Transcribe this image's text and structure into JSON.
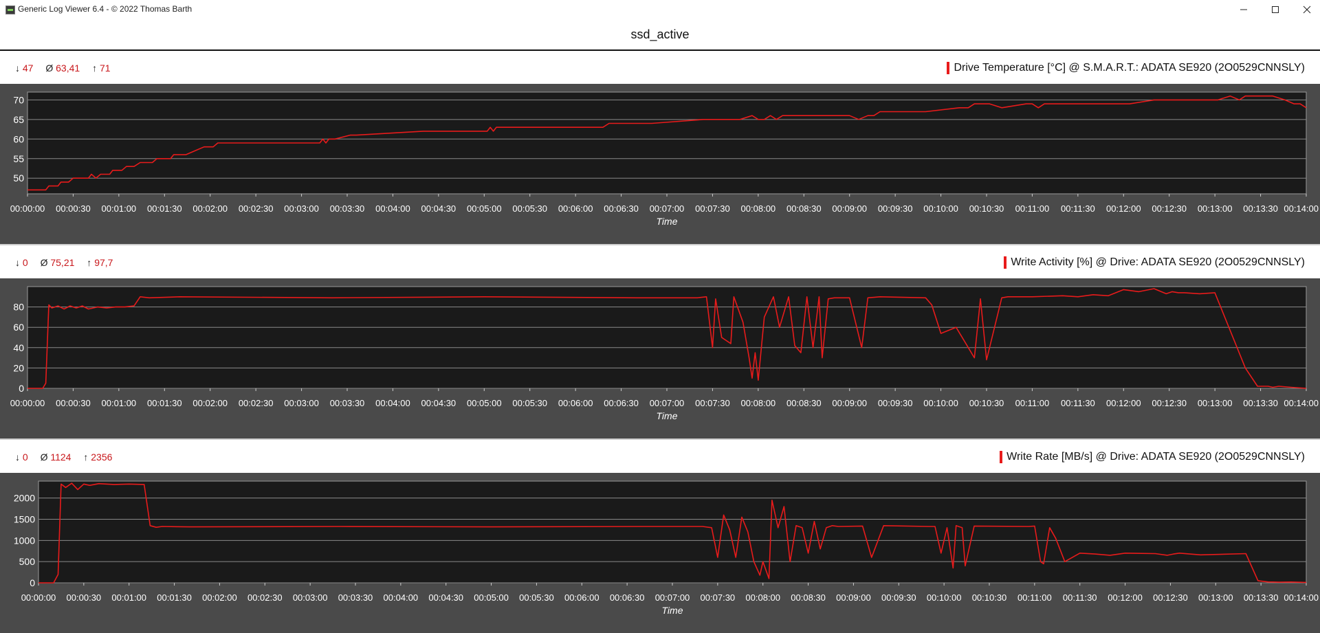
{
  "window": {
    "title": "Generic Log Viewer 6.4 - © 2022 Thomas Barth",
    "caption": "ssd_active"
  },
  "time_ticks": [
    "00:00:00",
    "00:00:30",
    "00:01:00",
    "00:01:30",
    "00:02:00",
    "00:02:30",
    "00:03:00",
    "00:03:30",
    "00:04:00",
    "00:04:30",
    "00:05:00",
    "00:05:30",
    "00:06:00",
    "00:06:30",
    "00:07:00",
    "00:07:30",
    "00:08:00",
    "00:08:30",
    "00:09:00",
    "00:09:30",
    "00:10:00",
    "00:10:30",
    "00:11:00",
    "00:11:30",
    "00:12:00",
    "00:12:30",
    "00:13:00",
    "00:13:30",
    "00:14:00"
  ],
  "colors": {
    "series": "#e81b1b",
    "plot_bg": "#1a1a1a",
    "frame_bg": "#4a4a4a",
    "grid": "#8a8a8a",
    "stats": "#c8161a"
  },
  "panels": [
    {
      "stats": {
        "min_symbol": "↓",
        "min": "47",
        "avg_symbol": "Ø",
        "avg": "63,41",
        "max_symbol": "↑",
        "max": "71"
      },
      "legend": "Drive Temperature [°C] @ S.M.A.R.T.: ADATA SE920 (2O0529CNNSLY)"
    },
    {
      "stats": {
        "min_symbol": "↓",
        "min": "0",
        "avg_symbol": "Ø",
        "avg": "75,21",
        "max_symbol": "↑",
        "max": "97,7"
      },
      "legend": "Write Activity [%] @ Drive: ADATA SE920 (2O0529CNNSLY)"
    },
    {
      "stats": {
        "min_symbol": "↓",
        "min": "0",
        "avg_symbol": "Ø",
        "avg": "1124",
        "max_symbol": "↑",
        "max": "2356"
      },
      "legend": "Write Rate [MB/s] @ Drive: ADATA SE920 (2O0529CNNSLY)"
    }
  ],
  "chart_data": [
    {
      "type": "line",
      "xlabel": "Time",
      "ylabel": "",
      "xlim": [
        0,
        840
      ],
      "ylim": [
        46,
        72
      ],
      "yticks": [
        50,
        55,
        60,
        65,
        70
      ],
      "grid": true,
      "series": [
        {
          "name": "Drive Temperature [°C] @ S.M.A.R.T.: ADATA SE920 (2O0529CNNSLY)",
          "x": [
            0,
            12,
            14,
            20,
            22,
            27,
            30,
            40,
            42,
            45,
            48,
            54,
            56,
            62,
            65,
            70,
            74,
            82,
            85,
            88,
            94,
            96,
            104,
            110,
            116,
            122,
            125,
            128,
            134,
            140,
            192,
            194,
            196,
            198,
            202,
            212,
            216,
            260,
            264,
            302,
            304,
            306,
            308,
            312,
            378,
            382,
            410,
            444,
            468,
            476,
            480,
            484,
            488,
            492,
            496,
            504,
            508,
            540,
            546,
            552,
            556,
            560,
            564,
            590,
            612,
            618,
            622,
            624,
            632,
            640,
            656,
            660,
            664,
            668,
            724,
            740,
            748,
            756,
            782,
            790,
            796,
            800,
            808,
            812,
            818,
            826,
            832,
            836,
            840
          ],
          "y": [
            47,
            47,
            48,
            48,
            49,
            49,
            50,
            50,
            51,
            50,
            51,
            51,
            52,
            52,
            53,
            53,
            54,
            54,
            55,
            55,
            55,
            56,
            56,
            57,
            58,
            58,
            59,
            59,
            59,
            59,
            59,
            60,
            59,
            60,
            60,
            61,
            61,
            62,
            62,
            62,
            63,
            62,
            63,
            63,
            63,
            64,
            64,
            65,
            65,
            66,
            65,
            65,
            66,
            65,
            66,
            66,
            66,
            66,
            65,
            66,
            66,
            67,
            67,
            67,
            68,
            68,
            69,
            69,
            69,
            68,
            69,
            69,
            68,
            69,
            69,
            70,
            70,
            70,
            70,
            71,
            70,
            71,
            71,
            71,
            71,
            70,
            69,
            69,
            68
          ]
        }
      ]
    },
    {
      "type": "line",
      "xlabel": "Time",
      "ylabel": "",
      "xlim": [
        0,
        840
      ],
      "ylim": [
        0,
        100
      ],
      "yticks": [
        0,
        20,
        40,
        60,
        80
      ],
      "grid": true,
      "series": [
        {
          "name": "Write Activity [%] @ Drive: ADATA SE920 (2O0529CNNSLY)",
          "x": [
            0,
            10,
            12,
            14,
            16,
            20,
            24,
            28,
            32,
            36,
            40,
            46,
            52,
            58,
            64,
            70,
            74,
            80,
            100,
            200,
            300,
            400,
            440,
            446,
            450,
            452,
            456,
            462,
            464,
            470,
            474,
            476,
            478,
            480,
            484,
            490,
            494,
            500,
            504,
            508,
            512,
            516,
            520,
            522,
            526,
            530,
            540,
            548,
            552,
            560,
            590,
            594,
            600,
            610,
            622,
            626,
            630,
            640,
            644,
            650,
            660,
            680,
            690,
            700,
            710,
            720,
            730,
            740,
            748,
            752,
            756,
            760,
            770,
            780,
            800,
            808,
            815,
            818,
            822,
            830,
            840
          ],
          "y": [
            0,
            0,
            5,
            82,
            79,
            81,
            78,
            81,
            79,
            81,
            78,
            80,
            79,
            80,
            80,
            81,
            90,
            89,
            90,
            89,
            90,
            89,
            89,
            90,
            40,
            88,
            50,
            44,
            90,
            65,
            30,
            10,
            35,
            8,
            70,
            90,
            60,
            90,
            42,
            35,
            90,
            40,
            90,
            30,
            88,
            89,
            89,
            40,
            89,
            90,
            89,
            82,
            54,
            60,
            30,
            88,
            28,
            89,
            90,
            90,
            90,
            91,
            90,
            92,
            91,
            97,
            95,
            98,
            93,
            95,
            94,
            94,
            93,
            94,
            20,
            2,
            2,
            1,
            2,
            1,
            0
          ]
        }
      ]
    },
    {
      "type": "line",
      "xlabel": "Time",
      "ylabel": "",
      "xlim": [
        0,
        840
      ],
      "ylim": [
        0,
        2400
      ],
      "yticks": [
        0,
        500,
        1000,
        1500,
        2000
      ],
      "grid": true,
      "series": [
        {
          "name": "Write Rate [MB/s] @ Drive: ADATA SE920 (2O0529CNNSLY)",
          "x": [
            0,
            10,
            13,
            15,
            18,
            22,
            26,
            30,
            34,
            40,
            50,
            60,
            70,
            74,
            78,
            82,
            100,
            200,
            300,
            400,
            440,
            446,
            450,
            454,
            458,
            462,
            466,
            470,
            474,
            478,
            480,
            484,
            486,
            490,
            494,
            498,
            502,
            506,
            510,
            514,
            518,
            522,
            526,
            530,
            546,
            552,
            560,
            590,
            594,
            598,
            602,
            606,
            608,
            612,
            614,
            620,
            656,
            660,
            664,
            666,
            670,
            674,
            680,
            690,
            700,
            710,
            720,
            740,
            748,
            752,
            756,
            770,
            800,
            808,
            815,
            818,
            822,
            830,
            840
          ],
          "y": [
            0,
            0,
            200,
            2330,
            2250,
            2350,
            2200,
            2330,
            2300,
            2340,
            2320,
            2330,
            2320,
            1350,
            1310,
            1330,
            1320,
            1330,
            1320,
            1330,
            1330,
            1300,
            600,
            1600,
            1250,
            600,
            1550,
            1200,
            500,
            180,
            500,
            100,
            1950,
            1300,
            1800,
            500,
            1350,
            1300,
            700,
            1450,
            800,
            1300,
            1350,
            1330,
            1340,
            600,
            1350,
            1330,
            1330,
            700,
            1300,
            350,
            1350,
            1300,
            400,
            1340,
            1330,
            1340,
            500,
            450,
            1300,
            1050,
            500,
            700,
            680,
            650,
            700,
            690,
            650,
            680,
            700,
            660,
            690,
            50,
            20,
            20,
            15,
            20,
            10
          ]
        }
      ]
    }
  ]
}
